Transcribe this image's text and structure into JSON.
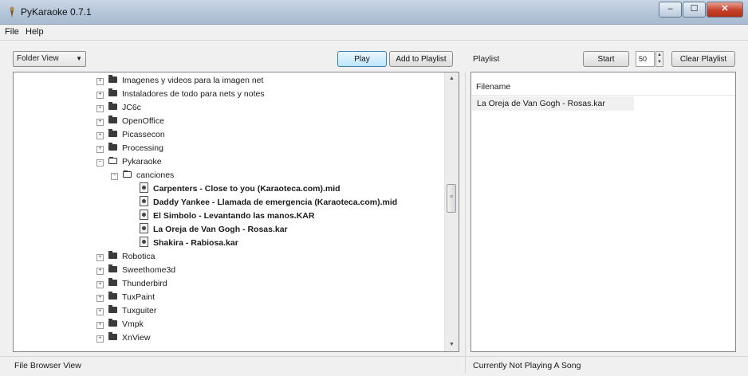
{
  "window": {
    "title": "PyKaraoke 0.7.1",
    "controls": [
      "–",
      "☐",
      "✕"
    ]
  },
  "menu": [
    "File",
    "Help"
  ],
  "toolbar": {
    "view_select": "Folder View",
    "play_label": "Play",
    "add_label": "Add to Playlist",
    "playlist_label": "Playlist",
    "start_label": "Start",
    "spin_value": "50",
    "clear_label": "Clear Playlist"
  },
  "tree": [
    {
      "label": "Imagenes y videos para la imagen net",
      "kind": "folder",
      "expander": "+"
    },
    {
      "label": "Instaladores de todo para nets y notes",
      "kind": "folder",
      "expander": "+"
    },
    {
      "label": "JC6c",
      "kind": "folder",
      "expander": "+"
    },
    {
      "label": "OpenOffice",
      "kind": "folder",
      "expander": "+"
    },
    {
      "label": "Picassecon",
      "kind": "folder",
      "expander": "+"
    },
    {
      "label": "Processing",
      "kind": "folder",
      "expander": "+"
    },
    {
      "label": "Pykaraoke",
      "kind": "folder-open",
      "expander": "−"
    },
    {
      "label": "canciones",
      "kind": "folder-open",
      "expander": "−"
    },
    {
      "label": "Carpenters - Close to you (Karaoteca.com).mid",
      "kind": "file"
    },
    {
      "label": "Daddy Yankee - Llamada de emergencia (Karaoteca.com).mid",
      "kind": "file"
    },
    {
      "label": "El Simbolo - Levantando las manos.KAR",
      "kind": "file"
    },
    {
      "label": "La Oreja de Van Gogh - Rosas.kar",
      "kind": "file"
    },
    {
      "label": "Shakira - Rabiosa.kar",
      "kind": "file"
    },
    {
      "label": "Robotica",
      "kind": "folder",
      "expander": "+"
    },
    {
      "label": "Sweethome3d",
      "kind": "folder",
      "expander": "+"
    },
    {
      "label": "Thunderbird",
      "kind": "folder",
      "expander": "+"
    },
    {
      "label": "TuxPaint",
      "kind": "folder",
      "expander": "+"
    },
    {
      "label": "Tuxguiter",
      "kind": "folder",
      "expander": "+"
    },
    {
      "label": "Vmpk",
      "kind": "folder",
      "expander": "+"
    },
    {
      "label": "XnView",
      "kind": "folder",
      "expander": "+"
    }
  ],
  "playlist": {
    "column_header": "Filename",
    "items": [
      "La Oreja de Van Gogh - Rosas.kar"
    ]
  },
  "status": {
    "left": "File Browser View",
    "right": "Currently Not Playing A Song"
  }
}
